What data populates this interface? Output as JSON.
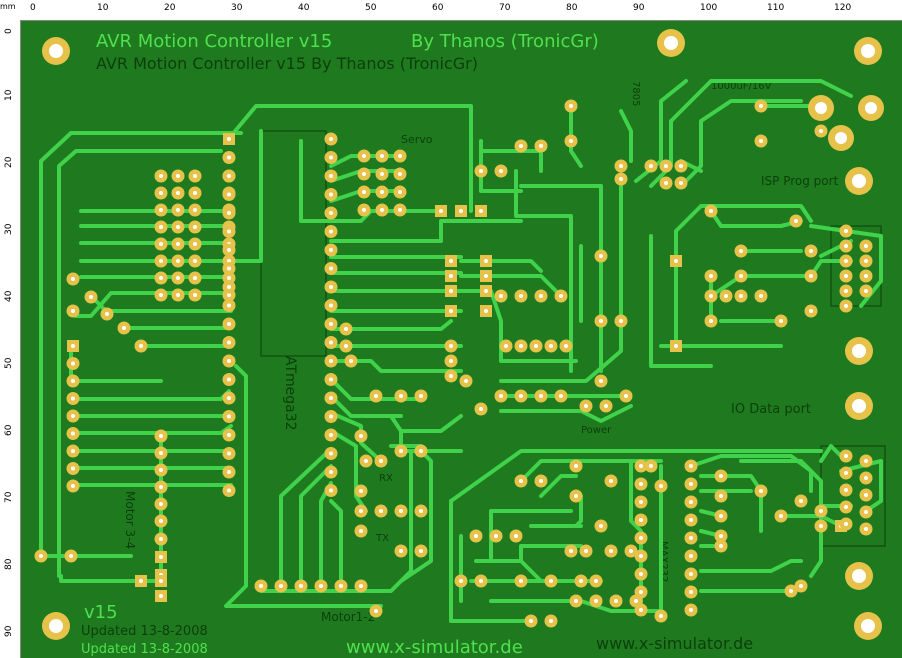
{
  "ruler": {
    "unit": "mm",
    "h_ticks": [
      "0",
      "10",
      "20",
      "30",
      "40",
      "50",
      "60",
      "70",
      "80",
      "90",
      "100",
      "110",
      "120"
    ],
    "v_ticks": [
      "0",
      "10",
      "20",
      "30",
      "40",
      "50",
      "60",
      "70",
      "80",
      "90"
    ]
  },
  "board": {
    "title": "AVR Motion Controller v15",
    "author": "By Thanos (TronicGr)",
    "author_mirror": "AVR Motion Controller v15   By Thanos (TronicGr)",
    "version": "v15",
    "updated": "Updated 13-8-2008",
    "updated_mirror": "Updated 13-8-2008",
    "website": "www.x-simulator.de",
    "website_mirror": "www.x-simulator.de",
    "chip": "ATmega32",
    "labels": {
      "servo": "Servo",
      "isp": "ISP Prog port",
      "io": "IO Data port",
      "motor12": "Motor1-2",
      "motor34": "Motor 3-4",
      "caps": "1000uF/16V",
      "regulator": "7805",
      "power": "Power",
      "rx": "RX",
      "tx": "TX",
      "max232": "MAX232"
    },
    "colors": {
      "board": "#1f7a1f",
      "trace": "#3fd24a",
      "pad_ring": "#e6c24a",
      "silk_top": "#4fe04f",
      "silk_bottom": "#0b3f0b"
    }
  }
}
